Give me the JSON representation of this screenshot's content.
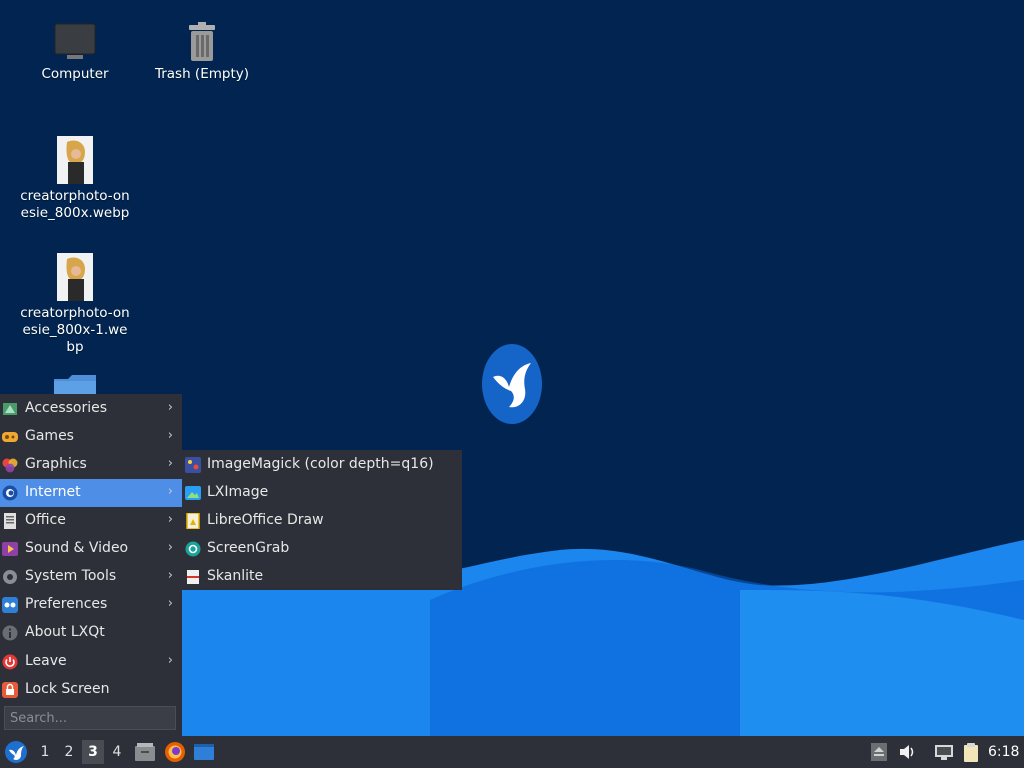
{
  "desktop": {
    "icons": [
      {
        "label": "Computer"
      },
      {
        "label": "Trash (Empty)"
      },
      {
        "label": "creatorphoto-onesie_800x.webp"
      },
      {
        "label": "creatorphoto-onesie_800x-1.webp"
      }
    ]
  },
  "menu": {
    "items": [
      {
        "label": "Accessories",
        "icon": "accessories-icon"
      },
      {
        "label": "Games",
        "icon": "games-icon"
      },
      {
        "label": "Graphics",
        "icon": "graphics-icon"
      },
      {
        "label": "Internet",
        "icon": "internet-icon"
      },
      {
        "label": "Office",
        "icon": "office-icon"
      },
      {
        "label": "Sound & Video",
        "icon": "sound-video-icon"
      },
      {
        "label": "System Tools",
        "icon": "system-tools-icon"
      },
      {
        "label": "Preferences",
        "icon": "preferences-icon"
      },
      {
        "label": "About LXQt",
        "icon": "info-icon"
      },
      {
        "label": "Leave",
        "icon": "power-icon"
      },
      {
        "label": "Lock Screen",
        "icon": "lock-icon"
      }
    ],
    "search_placeholder": "Search...",
    "chevron": "›"
  },
  "submenu": {
    "items": [
      {
        "label": "ImageMagick (color depth=q16)",
        "icon": "imagemagick-icon"
      },
      {
        "label": "LXImage",
        "icon": "lximage-icon"
      },
      {
        "label": "LibreOffice Draw",
        "icon": "libreoffice-draw-icon"
      },
      {
        "label": "ScreenGrab",
        "icon": "screengrab-icon"
      },
      {
        "label": "Skanlite",
        "icon": "skanlite-icon"
      }
    ]
  },
  "taskbar": {
    "workspaces": [
      "1",
      "2",
      "3",
      "4"
    ],
    "active_workspace": "3",
    "clock": "6:18"
  },
  "colors": {
    "desktop_bg": "#012550",
    "wave_light": "#1e8ef0",
    "wave_dark": "#0a63d8",
    "menu_bg": "#2d3038",
    "menu_highlight": "#4f8ee6",
    "taskbar_bg": "#2d3038"
  }
}
